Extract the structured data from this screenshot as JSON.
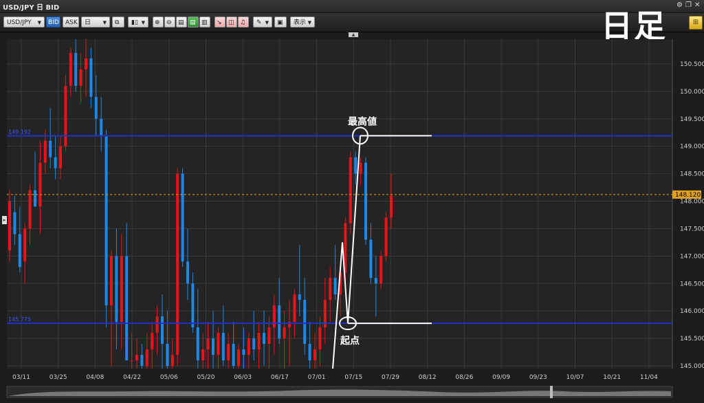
{
  "window": {
    "title": "USD/JPY 日 BID"
  },
  "overlay_title": "日足",
  "toolbar": {
    "symbol": "USD/JPY",
    "bid": "BID",
    "ask": "ASK",
    "period": "日",
    "display": "表示"
  },
  "annotations": {
    "high": "最高値",
    "start": "起点"
  },
  "chart_data": {
    "type": "candlestick",
    "x_ticks": [
      "03/11",
      "03/25",
      "04/08",
      "04/22",
      "05/06",
      "05/20",
      "06/03",
      "06/17",
      "07/01",
      "07/15",
      "07/29",
      "08/12",
      "08/26",
      "09/09",
      "09/23",
      "10/07",
      "10/21",
      "11/04"
    ],
    "y_ticks": [
      "150.500",
      "150.000",
      "149.500",
      "149.000",
      "148.500",
      "148.000",
      "147.500",
      "147.000",
      "146.500",
      "146.000",
      "145.500",
      "145.000"
    ],
    "ylim": [
      144.95,
      150.95
    ],
    "hlines": [
      {
        "label": "149.192",
        "value": 149.19,
        "color": "#1f2fd0"
      },
      {
        "label": "145.775",
        "value": 145.775,
        "color": "#1f2fd0"
      }
    ],
    "current_price": {
      "label": "148.120",
      "value": 148.12,
      "color": "#e0a020"
    },
    "up_color": "#e8141c",
    "down_color": "#1e88e8"
  }
}
